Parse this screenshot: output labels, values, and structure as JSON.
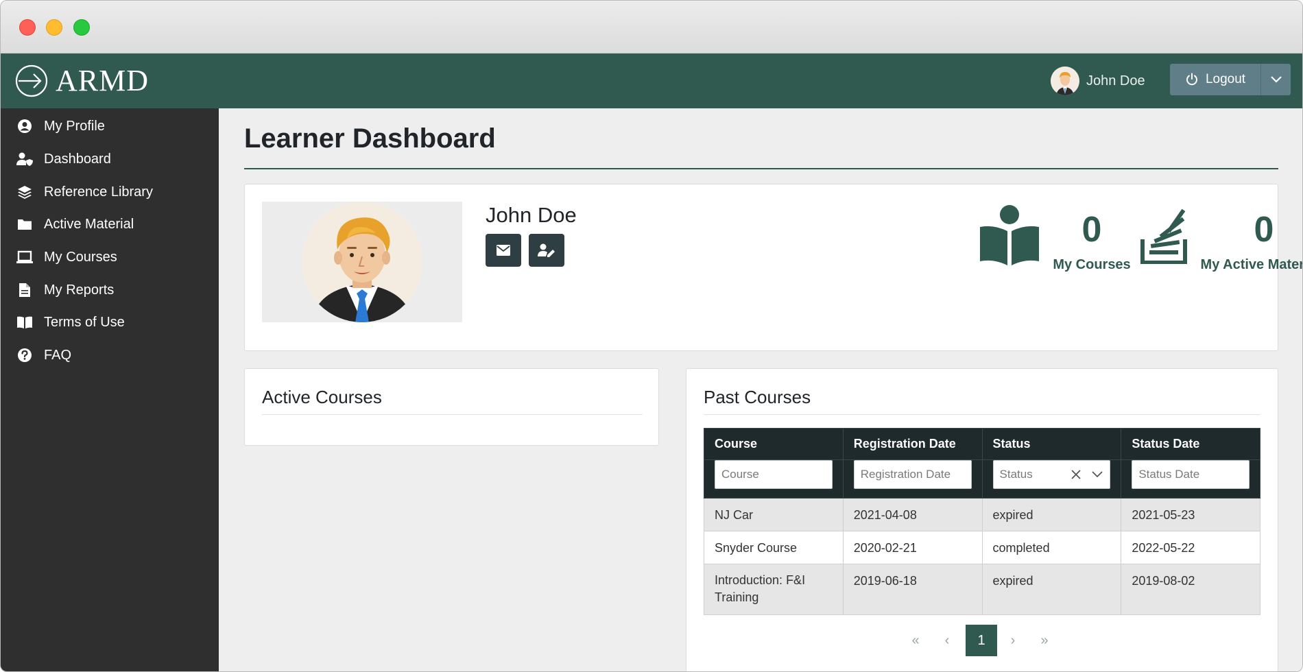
{
  "brand": {
    "logo_text": "ARMD"
  },
  "header": {
    "user_name": "John Doe",
    "logout_label": "Logout"
  },
  "sidebar": {
    "items": [
      {
        "label": "My Profile",
        "icon": "user-circle-icon"
      },
      {
        "label": "Dashboard",
        "icon": "user-shield-icon"
      },
      {
        "label": "Reference Library",
        "icon": "layers-icon"
      },
      {
        "label": "Active Material",
        "icon": "folder-icon"
      },
      {
        "label": "My Courses",
        "icon": "laptop-icon"
      },
      {
        "label": "My Reports",
        "icon": "file-icon"
      },
      {
        "label": "Terms of Use",
        "icon": "book-open-icon"
      },
      {
        "label": "FAQ",
        "icon": "question-circle-icon"
      }
    ]
  },
  "main": {
    "title": "Learner Dashboard",
    "profile": {
      "name": "John Doe",
      "email_icon": "envelope-icon",
      "edit_icon": "user-edit-icon"
    },
    "stats": [
      {
        "value": "0",
        "label": "My Courses",
        "icon": "reader-icon"
      },
      {
        "value": "0",
        "label": "My Active Materials",
        "icon": "stack-icon"
      }
    ],
    "active_courses": {
      "title": "Active Courses"
    },
    "past_courses": {
      "title": "Past Courses",
      "columns": [
        "Course",
        "Registration Date",
        "Status",
        "Status Date"
      ],
      "filters": {
        "course_placeholder": "Course",
        "registration_placeholder": "Registration Date",
        "status_placeholder": "Status",
        "status_date_placeholder": "Status Date"
      },
      "rows": [
        {
          "course": "NJ Car",
          "registration_date": "2021-04-08",
          "status": "expired",
          "status_date": "2021-05-23"
        },
        {
          "course": "Snyder Course",
          "registration_date": "2020-02-21",
          "status": "completed",
          "status_date": "2022-05-22"
        },
        {
          "course": "Introduction: F&I Training",
          "registration_date": "2019-06-18",
          "status": "expired",
          "status_date": "2019-08-02"
        }
      ],
      "pagination": {
        "current_page": "1",
        "first": "«",
        "prev": "‹",
        "next": "›",
        "last": "»"
      }
    }
  },
  "colors": {
    "brand_green": "#305a50",
    "sidebar_bg": "#2f2f2f",
    "table_header": "#1f2a2d",
    "logout_bg": "#5f7e88"
  }
}
